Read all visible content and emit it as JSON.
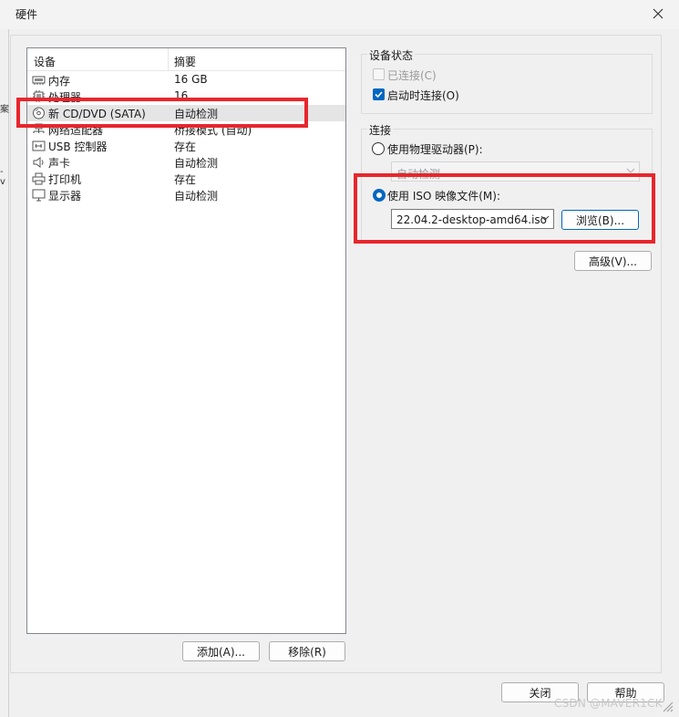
{
  "window": {
    "title": "硬件"
  },
  "background_fragments": {
    "left_a": "案",
    "left_b": "-v"
  },
  "device_list": {
    "col_device": "设备",
    "col_summary": "摘要",
    "rows": [
      {
        "name": "内存",
        "summary": "16 GB",
        "icon": "memory-icon",
        "selected": false
      },
      {
        "name": "处理器",
        "summary": "16",
        "icon": "processor-icon",
        "selected": false
      },
      {
        "name": "新 CD/DVD (SATA)",
        "summary": "自动检测",
        "icon": "cd-dvd-icon",
        "selected": true
      },
      {
        "name": "网络适配器",
        "summary": "桥接模式 (自动)",
        "icon": "network-adapter-icon",
        "selected": false
      },
      {
        "name": "USB 控制器",
        "summary": "存在",
        "icon": "usb-icon",
        "selected": false
      },
      {
        "name": "声卡",
        "summary": "自动检测",
        "icon": "speaker-icon",
        "selected": false
      },
      {
        "name": "打印机",
        "summary": "存在",
        "icon": "printer-icon",
        "selected": false
      },
      {
        "name": "显示器",
        "summary": "自动检测",
        "icon": "monitor-icon",
        "selected": false
      }
    ],
    "add_button": "添加(A)...",
    "remove_button": "移除(R)"
  },
  "device_status": {
    "title": "设备状态",
    "connected": {
      "label": "已连接(C)",
      "checked": false,
      "enabled": false
    },
    "connect_at_power_on": {
      "label": "启动时连接(O)",
      "checked": true
    }
  },
  "connection": {
    "title": "连接",
    "physical_drive": {
      "label": "使用物理驱动器(P):",
      "selected": false,
      "combo_value": "自动检测"
    },
    "iso_image": {
      "label": "使用 ISO 映像文件(M):",
      "selected": true,
      "file": "22.04.2-desktop-amd64.iso",
      "browse_button": "浏览(B)..."
    }
  },
  "advanced_button": "高级(V)...",
  "footer": {
    "close_button": "关闭",
    "help_button": "帮助"
  },
  "watermark": "CSDN @MAVER1CK",
  "colors": {
    "highlight": "#e8262c",
    "accent": "#0067c0",
    "selection": "#e5e5e5"
  }
}
